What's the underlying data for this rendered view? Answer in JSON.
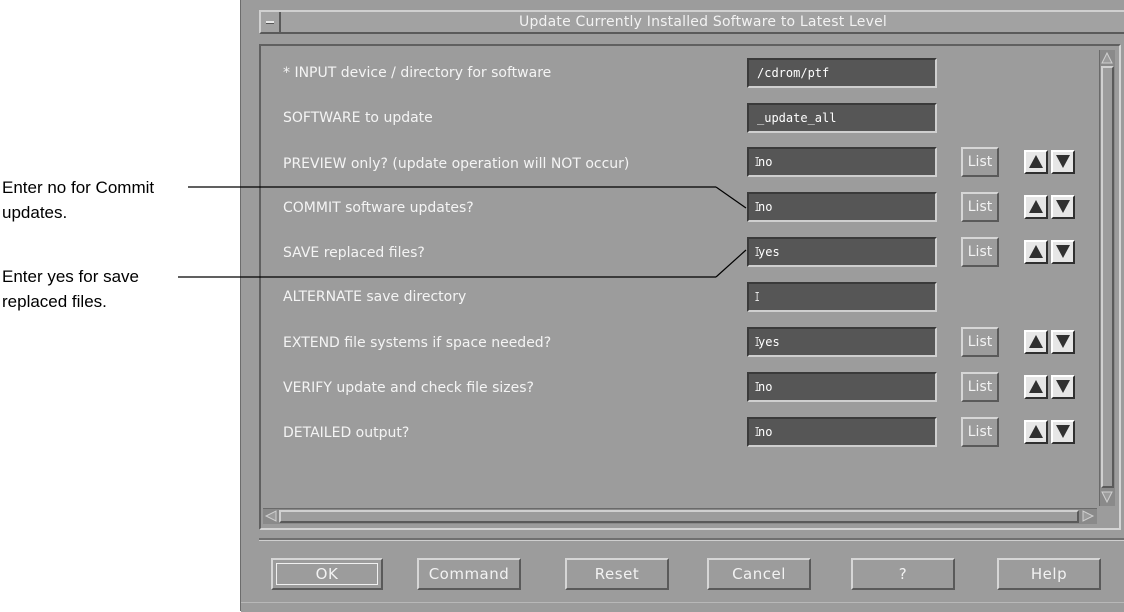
{
  "window": {
    "title": "Update Currently Installed Software to Latest Level"
  },
  "callouts": [
    {
      "text": "Enter no for Commit\nupdates."
    },
    {
      "text": "Enter yes for save\nreplaced files."
    }
  ],
  "fields": [
    {
      "label": "* INPUT device / directory for software",
      "value": "/cdrom/ptf"
    },
    {
      "label": "SOFTWARE to update",
      "value": "_update_all"
    },
    {
      "label": "PREVIEW only? (update operation will NOT occur)",
      "value": "no"
    },
    {
      "label": "COMMIT software updates?",
      "value": "no"
    },
    {
      "label": "SAVE replaced files?",
      "value": "yes"
    },
    {
      "label": "ALTERNATE save directory",
      "value": ""
    },
    {
      "label": "EXTEND file systems if space needed?",
      "value": "yes"
    },
    {
      "label": "VERIFY update and check file sizes?",
      "value": "no"
    },
    {
      "label": "DETAILED output?",
      "value": "no"
    }
  ],
  "list_label": "List",
  "buttons": {
    "ok": "OK",
    "command": "Command",
    "reset": "Reset",
    "cancel": "Cancel",
    "question": "?",
    "help": "Help"
  },
  "icons": {
    "window_menu": "window-menu-icon",
    "increment": "arrow-up-icon",
    "decrement": "arrow-down-icon"
  }
}
